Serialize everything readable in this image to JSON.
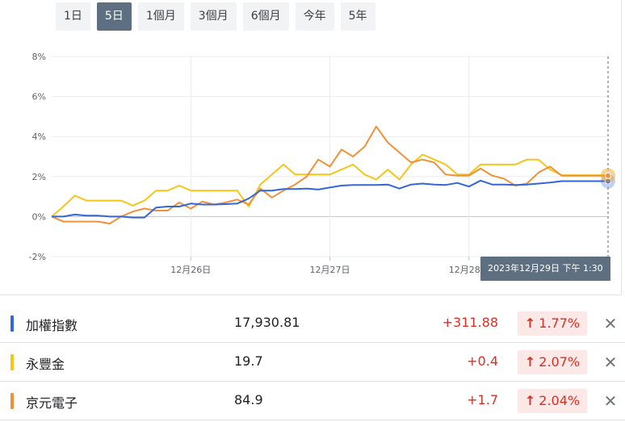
{
  "range_buttons": [
    {
      "label": "1日"
    },
    {
      "label": "5日",
      "active": true
    },
    {
      "label": "1個月"
    },
    {
      "label": "3個月"
    },
    {
      "label": "6個月"
    },
    {
      "label": "今年"
    },
    {
      "label": "5年"
    }
  ],
  "tooltip": "2023年12月29日 下午 1:30",
  "rows": [
    {
      "name": "加權指數",
      "price": "17,930.81",
      "change": "+311.88",
      "pct": "1.77%",
      "arrow": "↑",
      "close": "✕",
      "color": "#3367d6"
    },
    {
      "name": "永豐金",
      "price": "19.7",
      "change": "+0.4",
      "pct": "2.07%",
      "arrow": "↑",
      "close": "✕",
      "color": "#f5c518"
    },
    {
      "name": "京元電子",
      "price": "84.9",
      "change": "+1.7",
      "pct": "2.04%",
      "arrow": "↑",
      "close": "✕",
      "color": "#f0913a"
    }
  ],
  "chart_data": {
    "type": "line",
    "ylim": [
      -2,
      8
    ],
    "y_ticks": [
      "8%",
      "6%",
      "4%",
      "2%",
      "0%",
      "-2%"
    ],
    "y_tick_values": [
      8,
      6,
      4,
      2,
      0,
      -2
    ],
    "x_range": [
      0,
      48
    ],
    "x_ticks": [
      {
        "label": "12月26日",
        "x": 12
      },
      {
        "label": "12月27日",
        "x": 24
      },
      {
        "label": "12月28日",
        "x": 36
      }
    ],
    "grid": true,
    "series": [
      {
        "name": "加權指數",
        "color": "#3367d6",
        "x": [
          0,
          1,
          2,
          3,
          4,
          5,
          6,
          7,
          8,
          9,
          10,
          11,
          12,
          13,
          14,
          15,
          16,
          17,
          18,
          19,
          20,
          21,
          22,
          23,
          24,
          25,
          26,
          27,
          28,
          29,
          30,
          31,
          32,
          33,
          34,
          35,
          36,
          37,
          38,
          39,
          40,
          41,
          42,
          43,
          44,
          45,
          46,
          47,
          48
        ],
        "y": [
          0,
          0,
          0.1,
          0.05,
          0.05,
          0,
          0,
          -0.05,
          -0.05,
          0.45,
          0.5,
          0.5,
          0.65,
          0.6,
          0.6,
          0.62,
          0.65,
          0.9,
          1.3,
          1.3,
          1.38,
          1.38,
          1.4,
          1.35,
          1.45,
          1.55,
          1.58,
          1.58,
          1.58,
          1.6,
          1.4,
          1.6,
          1.65,
          1.6,
          1.58,
          1.68,
          1.5,
          1.8,
          1.6,
          1.6,
          1.58,
          1.6,
          1.65,
          1.7,
          1.77,
          1.77,
          1.77,
          1.77,
          1.77
        ]
      },
      {
        "name": "永豐金",
        "color": "#f5c518",
        "x": [
          0,
          1,
          2,
          3,
          4,
          5,
          6,
          7,
          8,
          9,
          10,
          11,
          12,
          13,
          14,
          15,
          16,
          17,
          18,
          19,
          20,
          21,
          22,
          23,
          24,
          25,
          26,
          27,
          28,
          29,
          30,
          31,
          32,
          33,
          34,
          35,
          36,
          37,
          38,
          39,
          40,
          41,
          42,
          43,
          44,
          45,
          46,
          47,
          48
        ],
        "y": [
          0,
          0.5,
          1.05,
          0.8,
          0.8,
          0.8,
          0.8,
          0.55,
          0.8,
          1.3,
          1.3,
          1.55,
          1.3,
          1.3,
          1.3,
          1.3,
          1.3,
          0.5,
          1.6,
          2.1,
          2.6,
          2.1,
          2.1,
          2.1,
          2.1,
          2.35,
          2.6,
          2.1,
          1.85,
          2.35,
          1.85,
          2.6,
          3.1,
          2.85,
          2.6,
          2.1,
          2.1,
          2.6,
          2.6,
          2.6,
          2.6,
          2.85,
          2.85,
          2.35,
          2.07,
          2.07,
          2.07,
          2.07,
          2.07
        ]
      },
      {
        "name": "京元電子",
        "color": "#f0913a",
        "x": [
          0,
          1,
          2,
          3,
          4,
          5,
          6,
          7,
          8,
          9,
          10,
          11,
          12,
          13,
          14,
          15,
          16,
          17,
          18,
          19,
          20,
          21,
          22,
          23,
          24,
          25,
          26,
          27,
          28,
          29,
          30,
          31,
          32,
          33,
          34,
          35,
          36,
          37,
          38,
          39,
          40,
          41,
          42,
          43,
          44,
          45,
          46,
          47,
          48
        ],
        "y": [
          0,
          -0.25,
          -0.25,
          -0.25,
          -0.25,
          -0.35,
          0,
          0.25,
          0.4,
          0.3,
          0.3,
          0.7,
          0.4,
          0.75,
          0.6,
          0.7,
          0.85,
          0.6,
          1.4,
          0.95,
          1.3,
          1.6,
          2,
          2.85,
          2.5,
          3.35,
          3,
          3.5,
          4.5,
          3.7,
          3.2,
          2.7,
          2.85,
          2.7,
          2.1,
          2.05,
          2.05,
          2.4,
          2.05,
          1.9,
          1.55,
          1.65,
          2.2,
          2.5,
          2.04,
          2.04,
          2.04,
          2.04,
          2.04
        ]
      }
    ]
  }
}
